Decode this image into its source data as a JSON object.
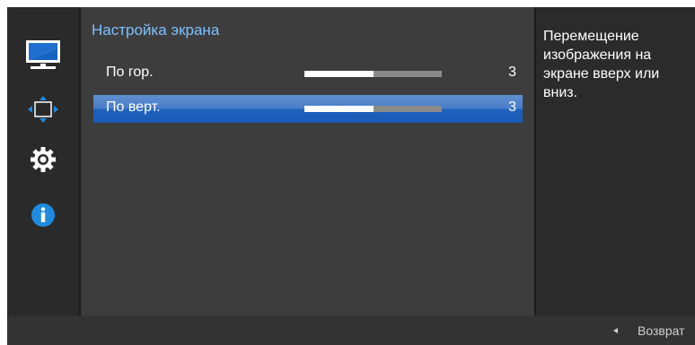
{
  "main": {
    "title": "Настройка экрана",
    "items": [
      {
        "label": "По гор.",
        "value": "3",
        "level": 0.5,
        "selected": false
      },
      {
        "label": "По верт.",
        "value": "3",
        "level": 0.5,
        "selected": true
      }
    ]
  },
  "sidebar": {
    "icons": [
      "picture-icon",
      "screen-adjust-icon",
      "gear-icon",
      "info-icon"
    ]
  },
  "help": {
    "text": "Перемещение изображения на экране вверх или вниз."
  },
  "footer": {
    "back_label": "Возврат"
  },
  "colors": {
    "accent": "#7ec0ff",
    "selection": "#1f62bf",
    "panel": "#3d3d3d",
    "sidebar": "#2a2a2a"
  }
}
